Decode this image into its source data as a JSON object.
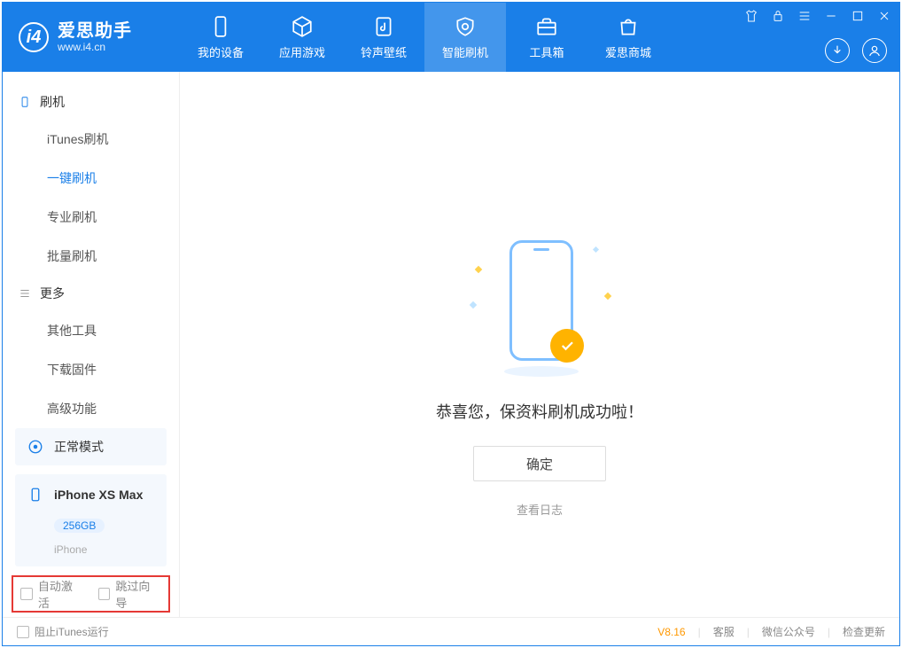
{
  "brand": {
    "name": "爱思助手",
    "url": "www.i4.cn"
  },
  "nav": {
    "items": [
      {
        "label": "我的设备"
      },
      {
        "label": "应用游戏"
      },
      {
        "label": "铃声壁纸"
      },
      {
        "label": "智能刷机"
      },
      {
        "label": "工具箱"
      },
      {
        "label": "爱思商城"
      }
    ]
  },
  "sidebar": {
    "section1": {
      "title": "刷机",
      "items": [
        "iTunes刷机",
        "一键刷机",
        "专业刷机",
        "批量刷机"
      ]
    },
    "section2": {
      "title": "更多",
      "items": [
        "其他工具",
        "下载固件",
        "高级功能"
      ]
    },
    "mode": "正常模式",
    "device": {
      "name": "iPhone XS Max",
      "capacity": "256GB",
      "type": "iPhone"
    },
    "options": {
      "autoActivate": "自动激活",
      "skipGuide": "跳过向导"
    }
  },
  "main": {
    "message": "恭喜您，保资料刷机成功啦！",
    "ok": "确定",
    "viewLog": "查看日志"
  },
  "status": {
    "blockItunes": "阻止iTunes运行",
    "version": "V8.16",
    "links": [
      "客服",
      "微信公众号",
      "检查更新"
    ]
  }
}
